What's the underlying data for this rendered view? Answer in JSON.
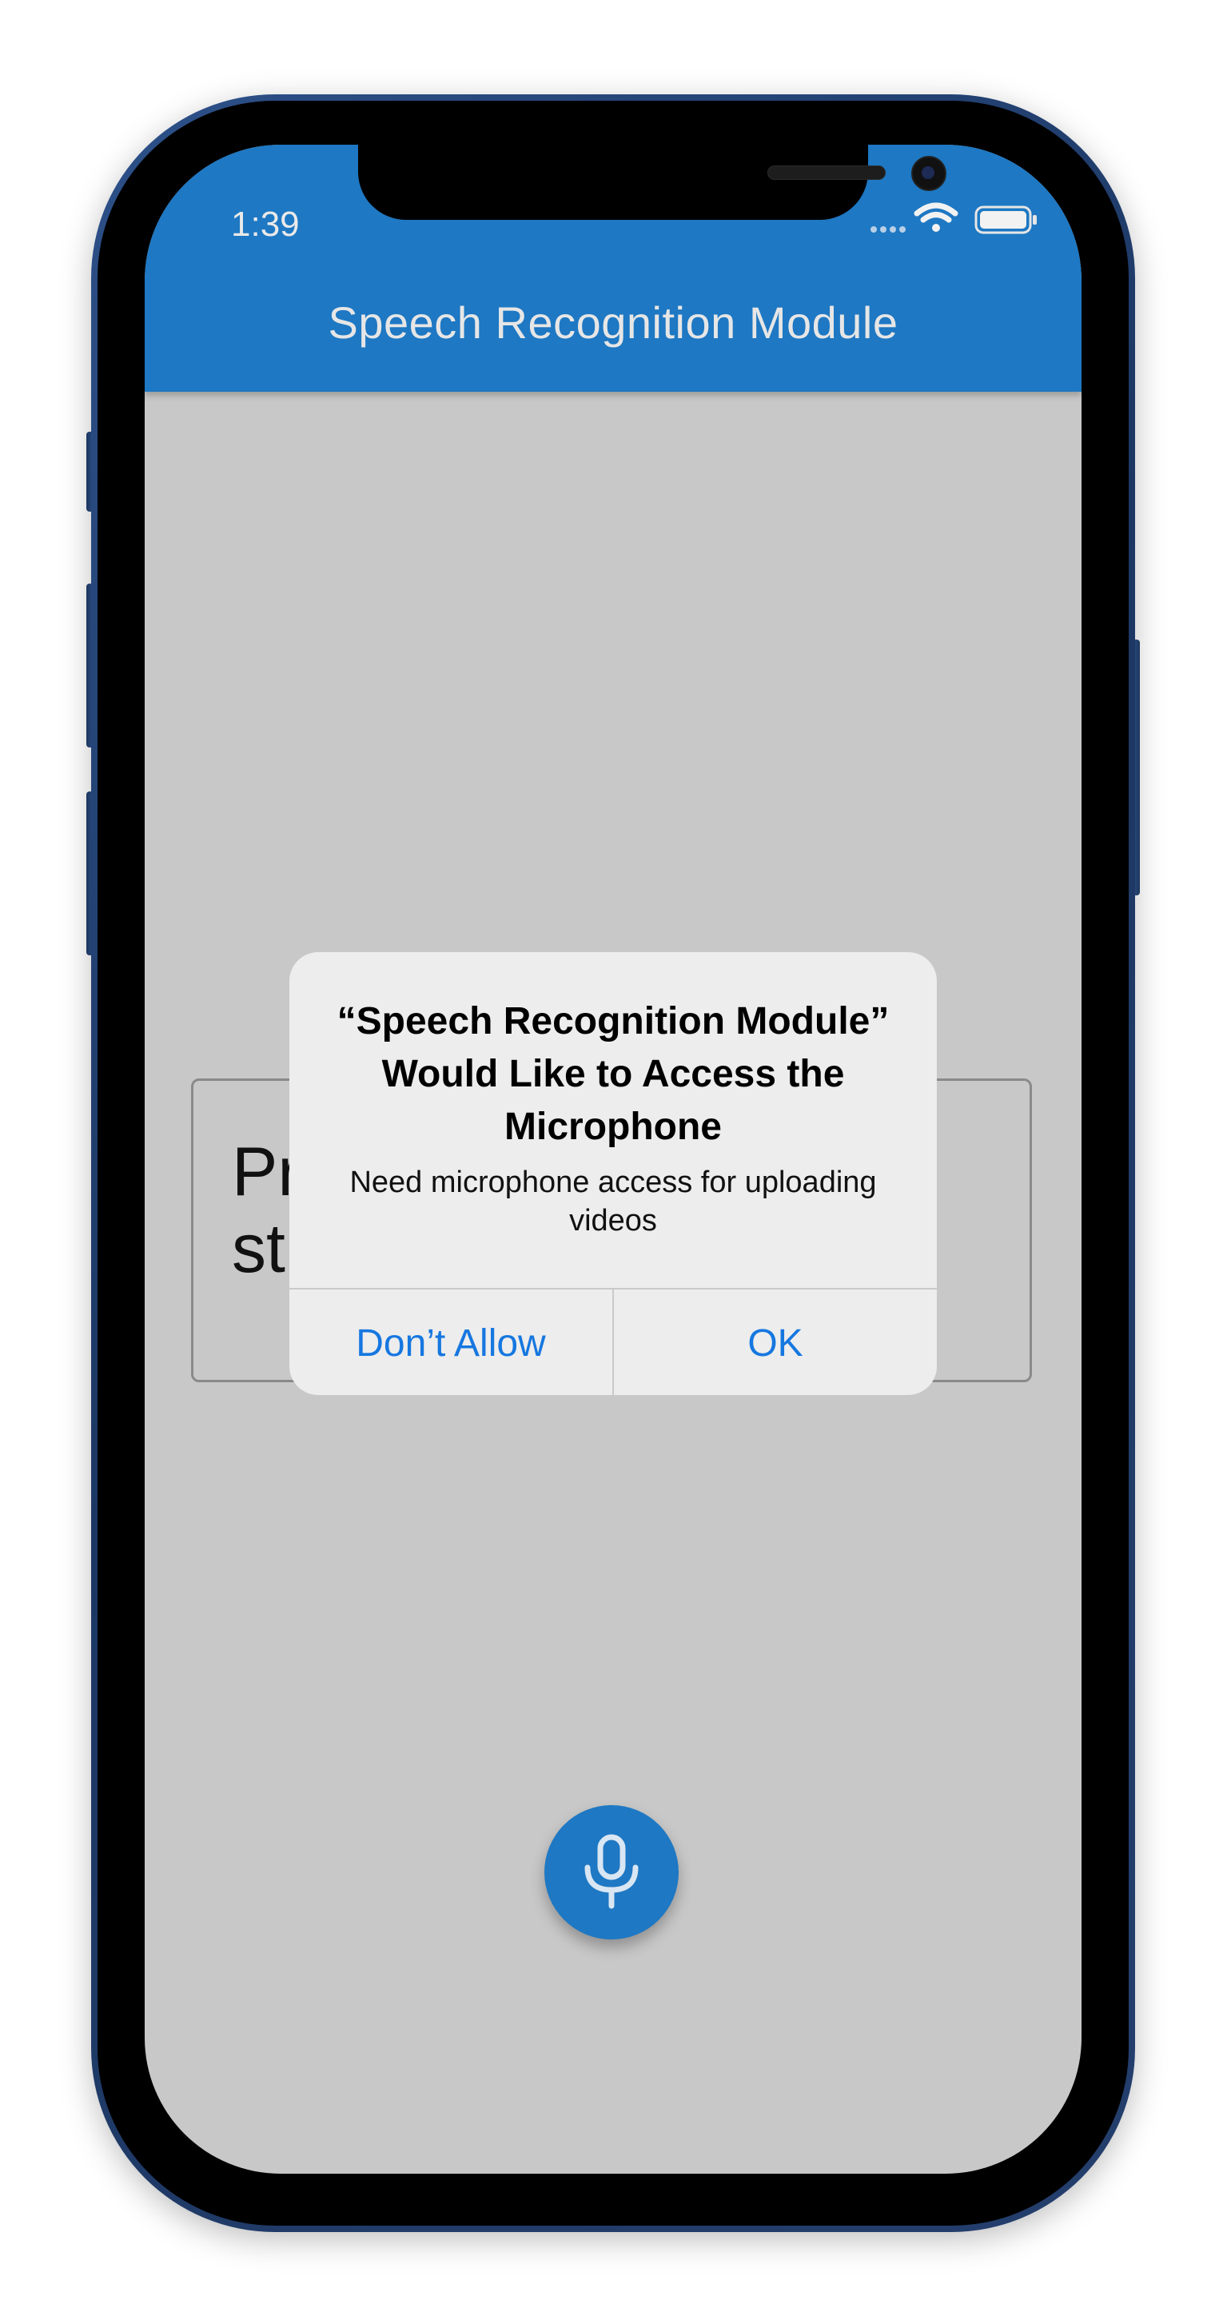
{
  "status_bar": {
    "time": "1:39"
  },
  "app_bar": {
    "title": "Speech Recognition Module",
    "color": "#1e78c3"
  },
  "content": {
    "text_box_visible_text": "Pr\nst"
  },
  "alert": {
    "title": "“Speech Recognition Module” Would Like to Access the Microphone",
    "message": "Need microphone access for uploading videos",
    "dont_allow_label": "Don’t Allow",
    "ok_label": "OK",
    "button_color": "#1677e0"
  },
  "fab": {
    "icon": "microphone-icon"
  }
}
